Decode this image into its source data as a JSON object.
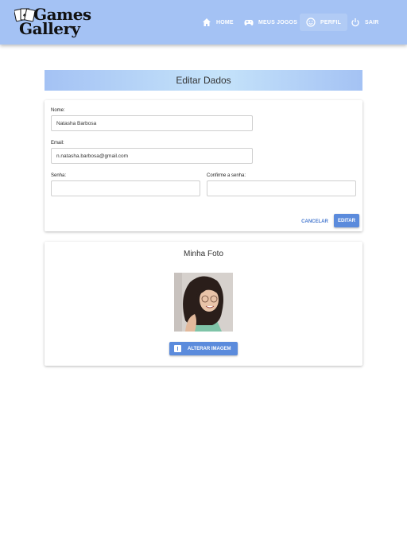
{
  "header": {
    "logo_line1": "Games",
    "logo_line2": "Gallery",
    "nav": [
      {
        "label": "HOME",
        "icon": "home-icon"
      },
      {
        "label": "MEUS JOGOS",
        "icon": "gamepad-icon"
      },
      {
        "label": "PERFIL",
        "icon": "smiley-icon",
        "active": true
      },
      {
        "label": "SAIR",
        "icon": "power-icon"
      }
    ]
  },
  "form": {
    "title": "Editar Dados",
    "name_label": "Nome:",
    "name_value": "Natasha Barbosa",
    "email_label": "Email:",
    "email_value": "n.natasha.barbosa@gmail.com",
    "password_label": "Senha:",
    "password_value": "",
    "confirm_label": "Confirme a senha:",
    "confirm_value": "",
    "cancel_label": "CANCELAR",
    "edit_label": "EDITAR"
  },
  "photo": {
    "title": "Minha Foto",
    "change_label": "ALTERAR IMAGEM"
  },
  "colors": {
    "header": "#a4c2f4",
    "accent": "#5b8bdc"
  }
}
